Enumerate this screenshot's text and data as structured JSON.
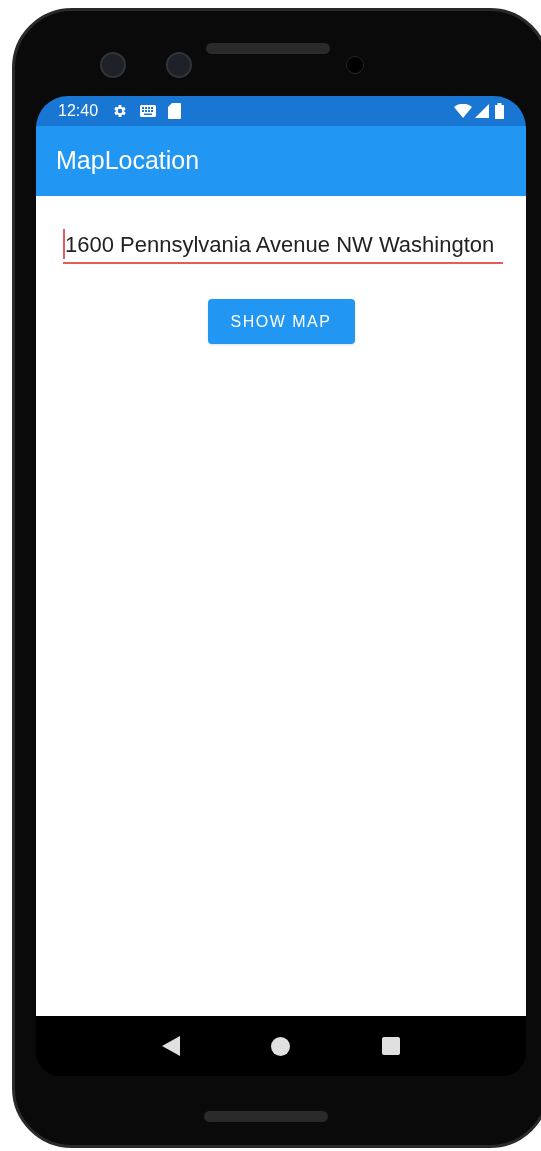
{
  "status_bar": {
    "time": "12:40"
  },
  "app_bar": {
    "title": "MapLocation"
  },
  "address_field": {
    "value": "1600 Pennsylvania Avenue NW Washington",
    "focused": true
  },
  "button": {
    "label": "SHOW MAP"
  }
}
